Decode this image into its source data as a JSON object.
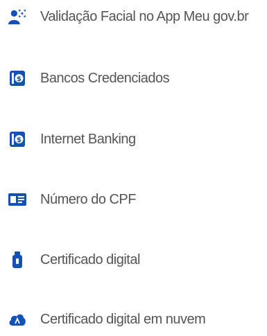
{
  "accent_color": "#1351b4",
  "text_color": "#555555",
  "options": [
    {
      "label": "Validação Facial no App Meu gov.br",
      "icon": "face-id-icon"
    },
    {
      "label": "Bancos Credenciados",
      "icon": "bank-icon"
    },
    {
      "label": "Internet Banking",
      "icon": "bank-icon"
    },
    {
      "label": "Número do CPF",
      "icon": "id-card-icon"
    },
    {
      "label": "Certificado digital",
      "icon": "usb-token-icon"
    },
    {
      "label": "Certificado digital em nuvem",
      "icon": "cloud-certificate-icon"
    }
  ]
}
